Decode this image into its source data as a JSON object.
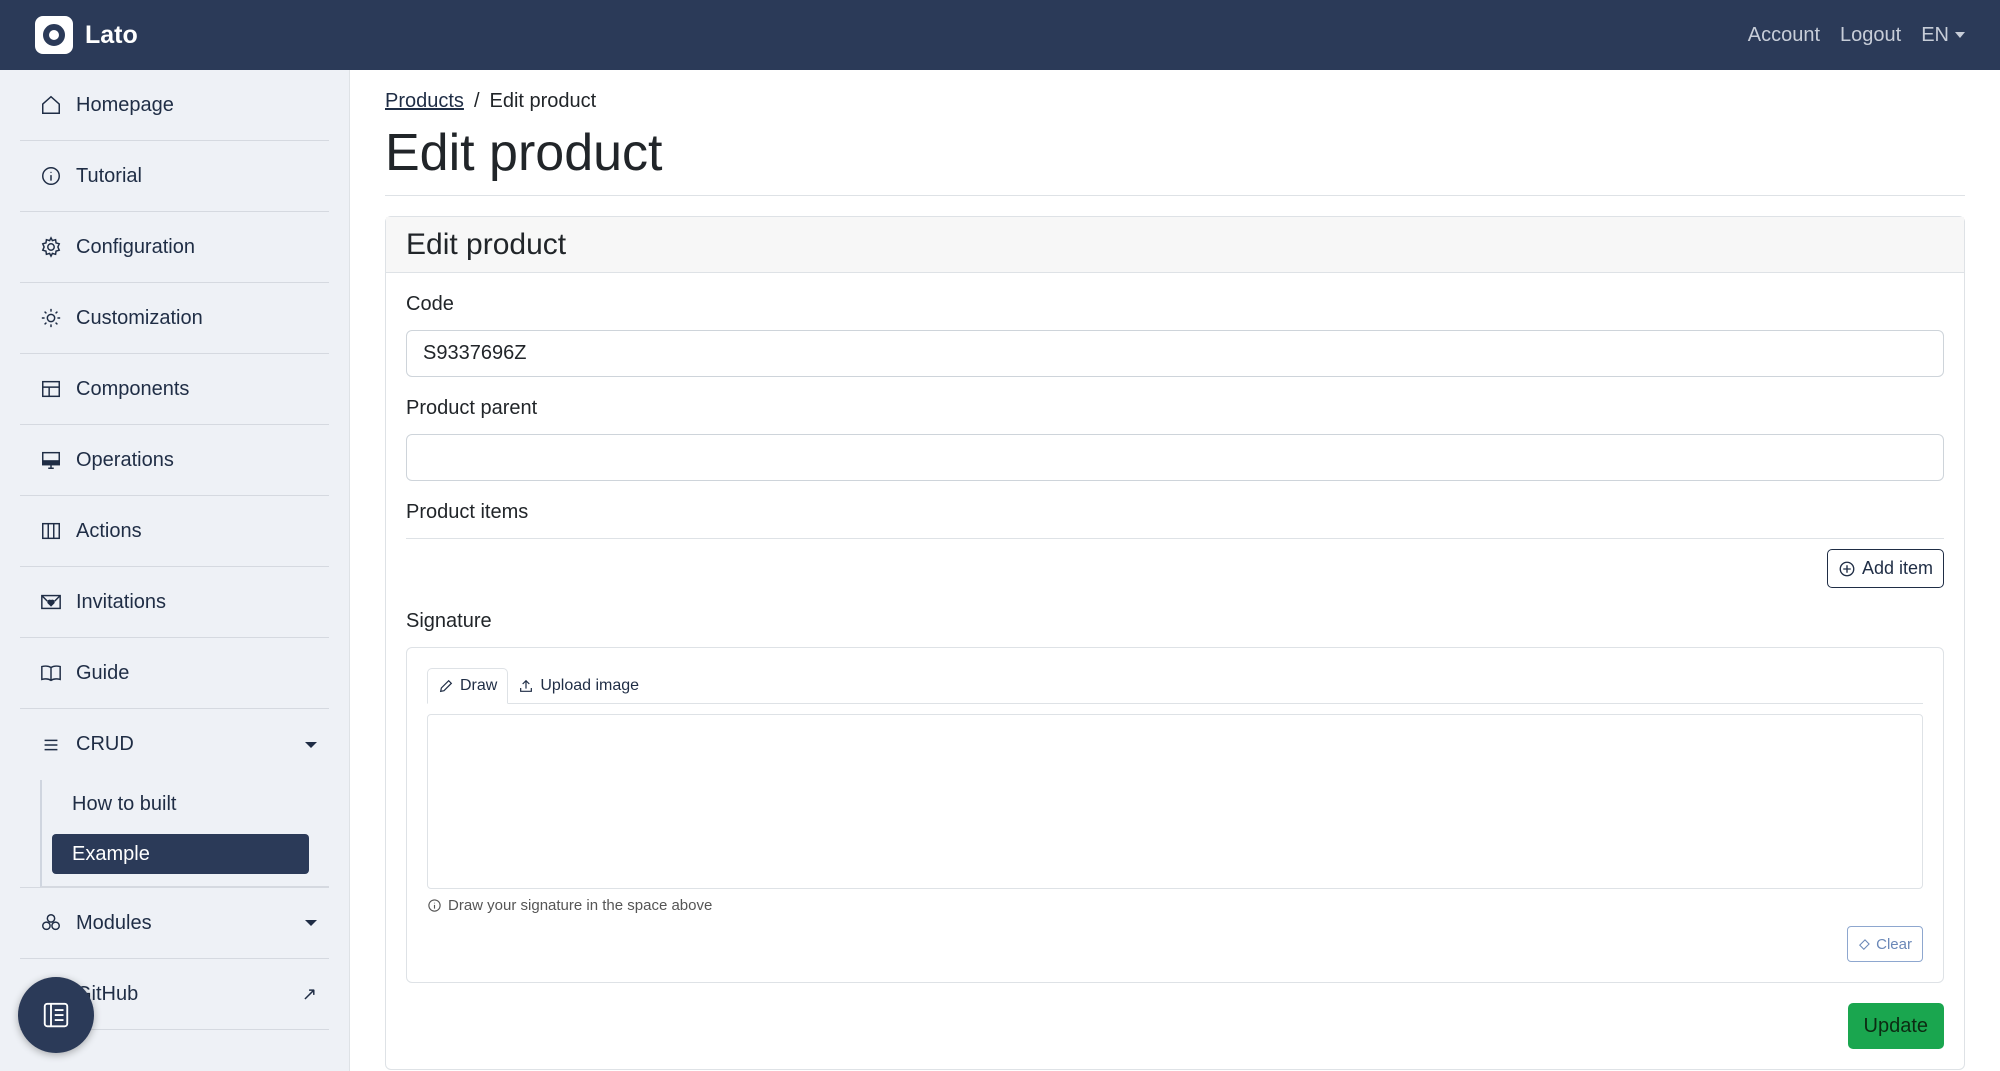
{
  "navbar": {
    "brand": "Lato",
    "account": "Account",
    "logout": "Logout",
    "language": "EN"
  },
  "sidebar": {
    "items": [
      {
        "label": "Homepage",
        "icon": "home-icon"
      },
      {
        "label": "Tutorial",
        "icon": "info-icon"
      },
      {
        "label": "Configuration",
        "icon": "gear-icon"
      },
      {
        "label": "Customization",
        "icon": "sun-icon"
      },
      {
        "label": "Components",
        "icon": "layout-icon"
      },
      {
        "label": "Operations",
        "icon": "monitor-icon"
      },
      {
        "label": "Actions",
        "icon": "columns-icon"
      },
      {
        "label": "Invitations",
        "icon": "envelope-heart-icon"
      },
      {
        "label": "Guide",
        "icon": "book-icon"
      }
    ],
    "crud": {
      "label": "CRUD",
      "children": [
        "How to built",
        "Example"
      ]
    },
    "modules": "Modules",
    "github": "GitHub"
  },
  "main": {
    "breadcrumb": {
      "parent": "Products",
      "current": "Edit product"
    },
    "title": "Edit product",
    "card_title": "Edit product",
    "form": {
      "code_label": "Code",
      "code_value": "S9337696Z",
      "parent_label": "Product parent",
      "parent_value": "",
      "items_label": "Product items",
      "add_item": "Add item",
      "signature_label": "Signature",
      "tab_draw": "Draw",
      "tab_upload": "Upload image",
      "signature_help": "Draw your signature in the space above",
      "clear": "Clear",
      "update": "Update"
    }
  }
}
